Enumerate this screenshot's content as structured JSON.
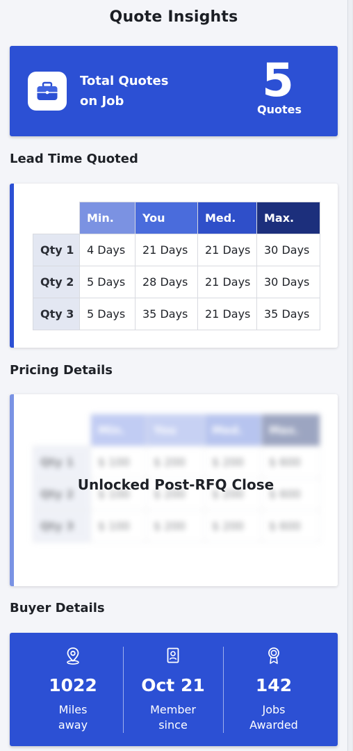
{
  "page": {
    "title": "Quote Insights"
  },
  "quotes_card": {
    "label_line1": "Total Quotes",
    "label_line2": "on Job",
    "count": "5",
    "unit": "Quotes",
    "icon": "briefcase-icon",
    "accent": "#2c50d4"
  },
  "lead_time": {
    "title": "Lead Time Quoted",
    "columns": [
      {
        "label": "Min.",
        "color": "#7b92e2"
      },
      {
        "label": "You",
        "color": "#4a6cdc"
      },
      {
        "label": "Med.",
        "color": "#2f4fc9"
      },
      {
        "label": "Max.",
        "color": "#1c2f7c"
      }
    ],
    "rows": [
      {
        "label": "Qty 1",
        "cells": [
          "4 Days",
          "21 Days",
          "21 Days",
          "30 Days"
        ]
      },
      {
        "label": "Qty 2",
        "cells": [
          "5 Days",
          "28 Days",
          "21 Days",
          "30 Days"
        ]
      },
      {
        "label": "Qty 3",
        "cells": [
          "5 Days",
          "35 Days",
          "21 Days",
          "35 Days"
        ]
      }
    ]
  },
  "pricing": {
    "title": "Pricing Details",
    "locked_message": "Unlocked Post-RFQ Close",
    "columns": [
      "Min.",
      "You",
      "Med.",
      "Max."
    ],
    "rows": [
      {
        "label": "Qty 1",
        "cells": [
          "$ 100",
          "$ 200",
          "$ 200",
          "$ 600"
        ]
      },
      {
        "label": "Qty 2",
        "cells": [
          "$ 100",
          "$ 200",
          "$ 200",
          "$ 600"
        ]
      },
      {
        "label": "Qty 3",
        "cells": [
          "$ 100",
          "$ 200",
          "$ 200",
          "$ 600"
        ]
      }
    ]
  },
  "buyer": {
    "title": "Buyer Details",
    "stats": [
      {
        "icon": "location-pin-icon",
        "value": "1022",
        "label": "Miles\naway"
      },
      {
        "icon": "id-badge-icon",
        "value": "Oct 21",
        "label": "Member\nsince"
      },
      {
        "icon": "award-ribbon-icon",
        "value": "142",
        "label": "Jobs\nAwarded"
      }
    ]
  }
}
